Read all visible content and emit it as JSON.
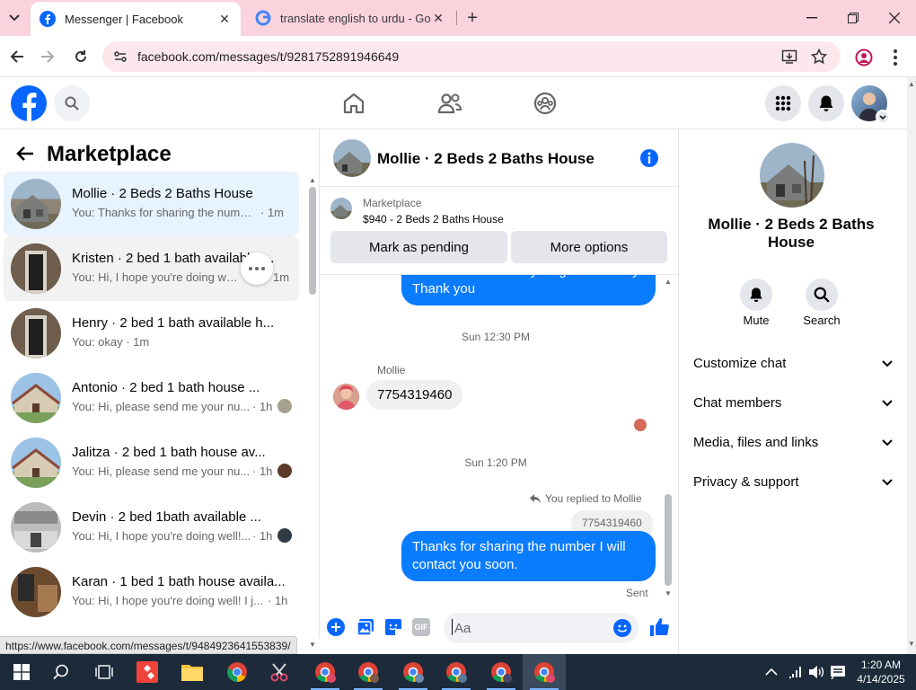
{
  "browser": {
    "tabs": [
      {
        "title": "Messenger | Facebook"
      },
      {
        "title": "translate english to urdu - Goog"
      }
    ],
    "url": "facebook.com/messages/t/9281752891946649",
    "status_url": "https://www.facebook.com/messages/t/9484923641553839/"
  },
  "sidebar": {
    "title": "Marketplace",
    "conversations": [
      {
        "name": "Mollie · 2 Beds 2 Baths House",
        "preview": "You: Thanks for sharing the numbe...",
        "time": "· 1m"
      },
      {
        "name": "Kristen · 2 bed 1 bath available h...",
        "preview": "You: Hi, I hope you're doing well! ...",
        "time": "1m"
      },
      {
        "name": "Henry · 2 bed 1 bath available h...",
        "preview": "You: okay · 1m",
        "time": ""
      },
      {
        "name": "Antonio · 2 bed 1 bath house ...",
        "preview": "You: Hi, please send me your nu...",
        "time": "· 1h"
      },
      {
        "name": "Jalitza · 2 bed 1 bath house av...",
        "preview": "You: Hi, please send me your nu...",
        "time": "· 1h"
      },
      {
        "name": "Devin · 2 bed 1bath available ...",
        "preview": "You: Hi, I hope you're doing well!...",
        "time": "· 1h"
      },
      {
        "name": "Karan · 1 bed 1 bath house availa...",
        "preview": "You: Hi, I hope you're doing well! I j...",
        "time": "· 1h"
      }
    ]
  },
  "chat": {
    "title": "Mollie · 2 Beds 2 Baths House",
    "listing_source": "Marketplace",
    "listing_title": "$940 - 2 Beds 2 Baths House",
    "mark_pending": "Mark as pending",
    "more_options": "More options",
    "messages": {
      "out_1": "can coordinate everything more easily. Thank you",
      "ts_1": "Sun 12:30 PM",
      "sender": "Mollie",
      "in_1": "7754319460",
      "ts_2": "Sun 1:20 PM",
      "replied": "You replied to Mollie",
      "quoted": "7754319460",
      "out_2": "Thanks for sharing the number I will contact you soon.",
      "status": "Sent"
    },
    "composer_placeholder": "Aa"
  },
  "details": {
    "name": "Mollie · 2 Beds 2 Baths House",
    "mute": "Mute",
    "search": "Search",
    "sections": [
      "Customize chat",
      "Chat members",
      "Media, files and links",
      "Privacy & support"
    ]
  },
  "taskbar": {
    "time": "1:20 AM",
    "date": "4/14/2025"
  },
  "colors": {
    "fb_blue": "#0866ff",
    "bubble_blue": "#0a7cff",
    "tab_strip": "#fbd3dc"
  }
}
